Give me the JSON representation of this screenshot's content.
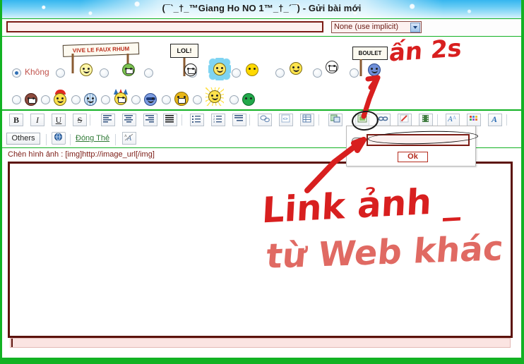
{
  "window": {
    "title": "(¯`_†_™Giang Ho NO 1™_†_´¯) - Gửi bài mới"
  },
  "subject": {
    "value": "",
    "placeholder": "",
    "icon_select": {
      "selected": "None (use implicit)",
      "options": [
        "None (use implicit)"
      ],
      "caret_icon": "chevron-down-icon"
    }
  },
  "emoticons": {
    "none_label": "Không",
    "row1": [
      {
        "name": "radio-none",
        "checked": true
      },
      {
        "name": "radio-emo-1",
        "checked": false,
        "icon": "banner-vive-le-faux-rhum",
        "label": "VIVE LE FAUX RHUM"
      },
      {
        "name": "radio-emo-2",
        "checked": false,
        "icon": "green-drunk-smiley"
      },
      {
        "name": "radio-emo-3",
        "checked": false,
        "icon": "lol-sign-smiley",
        "label": "LOL!"
      },
      {
        "name": "radio-emo-4",
        "checked": false,
        "icon": "blue-flower-smiley"
      },
      {
        "name": "radio-emo-5",
        "checked": false,
        "icon": "yellow-ball-smiley"
      },
      {
        "name": "radio-emo-6",
        "checked": false,
        "icon": "thumbs-up-smiley"
      },
      {
        "name": "radio-emo-7",
        "checked": false,
        "icon": "shocked-smiley"
      },
      {
        "name": "radio-emo-8",
        "checked": false,
        "icon": "boulet-sign-smiley",
        "label": "BOULET"
      }
    ],
    "row2": [
      {
        "name": "radio-emo-9",
        "checked": false,
        "icon": "brown-grin-smiley"
      },
      {
        "name": "radio-emo-10",
        "checked": false,
        "icon": "santa-hat-smiley"
      },
      {
        "name": "radio-emo-11",
        "checked": false,
        "icon": "grid-face-smiley"
      },
      {
        "name": "radio-emo-12",
        "checked": false,
        "icon": "jester-smiley"
      },
      {
        "name": "radio-emo-13",
        "checked": false,
        "icon": "blue-sunglasses-smiley"
      },
      {
        "name": "radio-emo-14",
        "checked": false,
        "icon": "gold-grin-smiley"
      },
      {
        "name": "radio-emo-15",
        "checked": false,
        "icon": "sun-smiley"
      },
      {
        "name": "radio-emo-16",
        "checked": false,
        "icon": "green-ball-smiley"
      }
    ]
  },
  "toolbar": {
    "row1": [
      {
        "name": "bold-button",
        "glyph": "B",
        "style": "bold"
      },
      {
        "name": "italic-button",
        "glyph": "I",
        "style": "italic"
      },
      {
        "name": "underline-button",
        "glyph": "U",
        "style": "underline"
      },
      {
        "name": "strikethrough-button",
        "glyph": "S",
        "style": "strike"
      },
      {
        "name": "align-left-button",
        "glyph": "align-left-icon"
      },
      {
        "name": "align-center-button",
        "glyph": "align-center-icon"
      },
      {
        "name": "align-right-button",
        "glyph": "align-right-icon"
      },
      {
        "name": "align-justify-button",
        "glyph": "align-justify-icon"
      },
      {
        "name": "bullet-list-button",
        "glyph": "bullet-list-icon"
      },
      {
        "name": "numbered-list-button",
        "glyph": "numbered-list-icon"
      },
      {
        "name": "indent-button",
        "glyph": "indent-icon"
      },
      {
        "name": "quote-button",
        "glyph": "quote-bubble-icon"
      },
      {
        "name": "code-button",
        "glyph": "code-icon"
      },
      {
        "name": "table-button",
        "glyph": "table-icon"
      },
      {
        "name": "save-image-button",
        "glyph": "save-image-icon"
      },
      {
        "name": "insert-image-button",
        "glyph": "insert-image-icon"
      },
      {
        "name": "insert-link-button",
        "glyph": "link-icon"
      },
      {
        "name": "edit-pencil-button",
        "glyph": "pencil-icon"
      },
      {
        "name": "insert-video-button",
        "glyph": "film-icon"
      },
      {
        "name": "font-style-button",
        "glyph": "font-a-icon"
      },
      {
        "name": "font-color-button",
        "glyph": "color-palette-icon"
      },
      {
        "name": "text-size-button",
        "glyph": "letter-a-icon"
      }
    ],
    "row2": {
      "others_label": "Others",
      "help_icon": "help-globe-icon",
      "close_tag_label": "Đóng Thẻ",
      "remove_format_icon": "remove-format-icon"
    },
    "hint": "Chèn hình ảnh : [img]http://image_url[/img]"
  },
  "link_popup": {
    "link_icon": "link-icon",
    "url_value": "",
    "url_placeholder": "",
    "ok_label": "Ok"
  },
  "editor": {
    "content": ""
  },
  "annotations": [
    {
      "name": "annotation-an-2s",
      "text": "ấn 2s"
    },
    {
      "name": "annotation-link-anh",
      "text": "Link ảnh _"
    },
    {
      "name": "annotation-tu-web-khac",
      "text": "từ Web khác"
    }
  ],
  "colors": {
    "green_border": "#12b223",
    "header_blue": "#64caf4",
    "dark_red": "#7b1b14",
    "annotation_red": "#d81f1f"
  }
}
